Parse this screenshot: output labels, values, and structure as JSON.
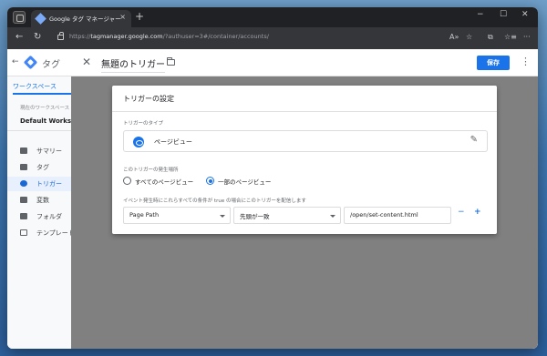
{
  "browser": {
    "tab_title": "Google タグ マネージャー",
    "tab_close": "×",
    "new_tab": "+",
    "url_prefix": "https://",
    "url_host": "tagmanager.google.com",
    "url_path": "/?authuser=3#/container/accounts/",
    "window_minimize": "−",
    "window_maximize": "☐",
    "window_close": "✕",
    "nav_back": "←",
    "nav_reload": "↻",
    "read_aloud": "A»",
    "favorite": "☆",
    "split": "⧉",
    "favorites": "☆≡",
    "more": "···"
  },
  "gtm": {
    "back_arrow": "←",
    "app_title": "タグ",
    "workspace_tab": "ワークスペース",
    "workspace_sub": "現在のワークスペース",
    "workspace_name": "Default Workspace",
    "nav": [
      {
        "label": "サマリー",
        "icon": "folder-icon"
      },
      {
        "label": "タグ",
        "icon": "tag-icon"
      },
      {
        "label": "トリガー",
        "icon": "trigger-icon"
      },
      {
        "label": "変数",
        "icon": "variable-icon"
      },
      {
        "label": "フォルダ",
        "icon": "folder-icon"
      },
      {
        "label": "テンプレート",
        "icon": "template-icon"
      }
    ],
    "close_x": "✕",
    "trigger_name": "無題のトリガー",
    "save": "保存",
    "more": "⋮"
  },
  "trigger_config": {
    "title": "トリガーの設定",
    "type_label": "トリガーのタイプ",
    "type_value": "ページビュー",
    "edit_icon": "✎",
    "fires_on_label": "このトリガーの発生場所",
    "radio_all": "すべてのページビュー",
    "radio_some": "一部のページビュー",
    "condition_label": "イベント発生時にこれらすべての条件が true の場合にこのトリガーを配信します",
    "variable": "Page Path",
    "operator": "先頭が一致",
    "value": "/open/set-content.html",
    "minus": "−",
    "plus": "+"
  }
}
